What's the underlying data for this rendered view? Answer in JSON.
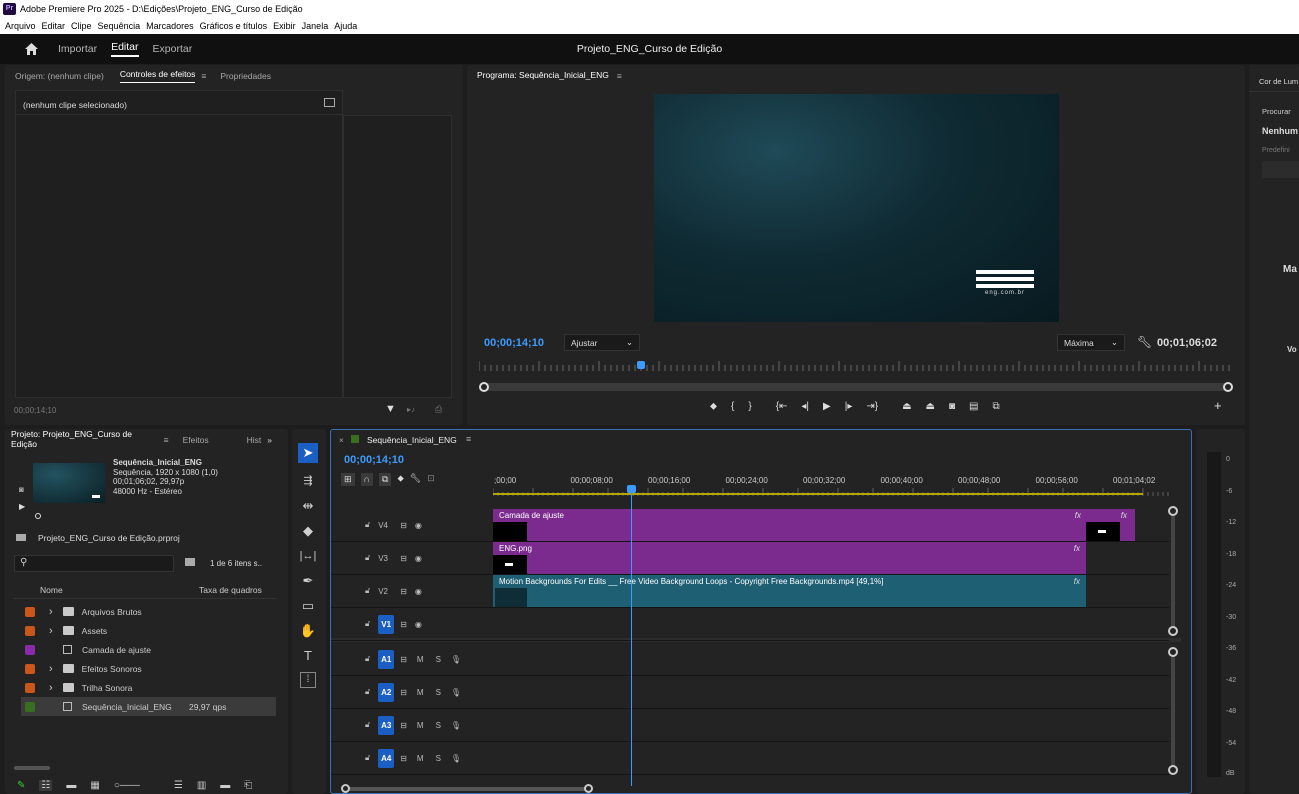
{
  "window": {
    "title": "Adobe Premiere Pro 2025 - D:\\Edições\\Projeto_ENG_Curso de Edição",
    "logo": "Pr"
  },
  "menu": [
    "Arquivo",
    "Editar",
    "Clipe",
    "Sequência",
    "Marcadores",
    "Gráficos e títulos",
    "Exibir",
    "Janela",
    "Ajuda"
  ],
  "appbar": {
    "home_icon": "home-icon",
    "importar": "Importar",
    "editar": "Editar",
    "exportar": "Exportar",
    "project_title": "Projeto_ENG_Curso de Edição"
  },
  "source_panel": {
    "tabs": {
      "origem": "Origem: (nenhum clipe)",
      "controles": "Controles de efeitos",
      "propriedades": "Propriedades"
    },
    "no_clip": "(nenhum clipe selecionado)",
    "timecode": "00;00;14;10"
  },
  "program": {
    "tab": "Programa: Sequência_Inicial_ENG",
    "timecode": "00;00;14;10",
    "fit": "Ajustar",
    "quality": "Máxima",
    "duration": "00;01;06;02",
    "logo_text": "eng.com.br"
  },
  "right_panel": {
    "tab": "Cor de Lum",
    "procurar": "Procurar",
    "nenhum": "Nenhum",
    "predef": "Predefini",
    "ma": "Ma",
    "vo": "Vo"
  },
  "project": {
    "tabs": {
      "projeto": "Projeto: Projeto_ENG_Curso de Edição",
      "efeitos": "Efeitos",
      "hist": "Hist"
    },
    "preview": {
      "name": "Sequência_Inicial_ENG",
      "line1": "Sequência, 1920 x 1080 (1,0)",
      "line2": "00;01;06;02, 29,97p",
      "line3": "48000 Hz - Estéreo"
    },
    "file": "Projeto_ENG_Curso de Edição.prproj",
    "count": "1 de 6 itens s..",
    "col_name": "Nome",
    "col_rate": "Taxa de quadros",
    "items": [
      {
        "name": "Arquivos Brutos",
        "color": "#c9561b",
        "rate": ""
      },
      {
        "name": "Assets",
        "color": "#c9561b",
        "rate": ""
      },
      {
        "name": "Camada de ajuste",
        "color": "#8a2aa8",
        "rate": ""
      },
      {
        "name": "Efeitos Sonoros",
        "color": "#c9561b",
        "rate": ""
      },
      {
        "name": "Trilha Sonora",
        "color": "#c9561b",
        "rate": ""
      },
      {
        "name": "Sequência_Inicial_ENG",
        "color": "#3a6e1f",
        "rate": "29,97 qps"
      }
    ]
  },
  "timeline": {
    "tab": "Sequência_Inicial_ENG",
    "timecode": "00;00;14;10",
    "ruler": [
      ";00;00",
      "00;00;08;00",
      "00;00;16;00",
      "00;00;24;00",
      "00;00;32;00",
      "00;00;40;00",
      "00;00;48;00",
      "00;00;56;00",
      "00;01;04;02"
    ],
    "video_tracks": [
      "V4",
      "V3",
      "V2",
      "V1"
    ],
    "audio_tracks": [
      "A1",
      "A2",
      "A3",
      "A4"
    ],
    "clips": {
      "adjust": "Camada de ajuste",
      "png": "ENG.png",
      "motion": "Motion Backgrounds For Edits __ Free Video Background Loops - Copyright Free Backgrounds.mp4 [49,1%]",
      "fx": "fx"
    },
    "track_letters": {
      "m": "M",
      "s": "S"
    }
  },
  "vu": {
    "labels": [
      "0",
      "-6",
      "-12",
      "-18",
      "-24",
      "-30",
      "-36",
      "-42",
      "-48",
      "-54",
      "dB"
    ]
  }
}
